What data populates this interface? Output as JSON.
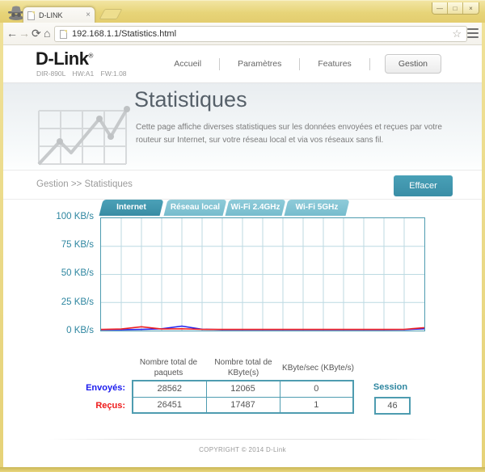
{
  "browser": {
    "tab_title": "D-LINK",
    "url": "192.168.1.1/Statistics.html",
    "icons": {
      "back": "←",
      "forward": "→",
      "reload": "⟳",
      "home": "⌂",
      "star": "☆"
    },
    "window_controls": [
      "—",
      "□",
      "×"
    ],
    "tab_close": "×"
  },
  "site": {
    "logo": "D-Link",
    "logo_reg": "®",
    "model_line": "DIR-890L HW:A1 FW:1.08",
    "nav": [
      {
        "label": "Accueil",
        "active": false
      },
      {
        "label": "Paramètres",
        "active": false
      },
      {
        "label": "Features",
        "active": false
      },
      {
        "label": "Gestion",
        "active": true
      }
    ]
  },
  "banner": {
    "title": "Statistiques",
    "description": "Cette page affiche diverses statistiques sur les données envoyées et reçues par votre routeur sur Internet, sur votre réseau local et via vos réseaux sans fil."
  },
  "breadcrumb": {
    "path": "Gestion >> Statistiques",
    "clear_button": "Effacer"
  },
  "tabs": [
    {
      "label": "Internet",
      "active": true
    },
    {
      "label": "Réseau local",
      "active": false
    },
    {
      "label": "Wi-Fi 2.4GHz",
      "active": false
    },
    {
      "label": "Wi-Fi 5GHz",
      "active": false
    }
  ],
  "chart_data": {
    "type": "line",
    "title": "",
    "xlabel": "",
    "ylabel": "",
    "ylim": [
      0,
      100
    ],
    "ytick_labels": [
      "100 KB/s",
      "75 KB/s",
      "50 KB/s",
      "25 KB/s",
      "0 KB/s"
    ],
    "grid": true,
    "legend": "none",
    "x_unit": "time (unlabeled)",
    "series": [
      {
        "name": "Envoyés",
        "color": "#2222ee",
        "values": [
          0.2,
          0.2,
          0.4,
          1.0,
          3.4,
          0.6,
          0.2,
          0.2,
          0.2,
          0.2,
          0.2,
          0.2,
          0.2,
          0.2,
          0.2,
          0.3,
          1.0
        ]
      },
      {
        "name": "Reçus",
        "color": "#ee2222",
        "values": [
          0.4,
          0.8,
          2.8,
          0.8,
          1.0,
          0.5,
          0.4,
          0.4,
          0.4,
          0.4,
          0.4,
          0.4,
          0.4,
          0.4,
          0.4,
          0.5,
          2.0
        ]
      }
    ]
  },
  "stats": {
    "col_headers": [
      [
        "Nombre total de",
        "paquets"
      ],
      [
        "Nombre total de",
        "KByte(s)"
      ],
      [
        "KByte/sec (KByte/s)",
        ""
      ]
    ],
    "rows": [
      {
        "label": "Envoyés:",
        "color": "#1a1aee",
        "values": [
          "28562",
          "12065",
          "0"
        ]
      },
      {
        "label": "Reçus:",
        "color": "#ee1a1a",
        "values": [
          "26451",
          "17487",
          "1"
        ]
      }
    ],
    "session": {
      "label": "Session",
      "value": "46"
    }
  },
  "footer": {
    "copyright": "COPYRIGHT © 2014 D-Link"
  },
  "colors": {
    "accent": "#3b91a9",
    "tab_inactive": "#7fc2d2",
    "chart_border": "#4e9cb0",
    "grid": "#bcdae2",
    "axis_label": "#2e86a0"
  }
}
